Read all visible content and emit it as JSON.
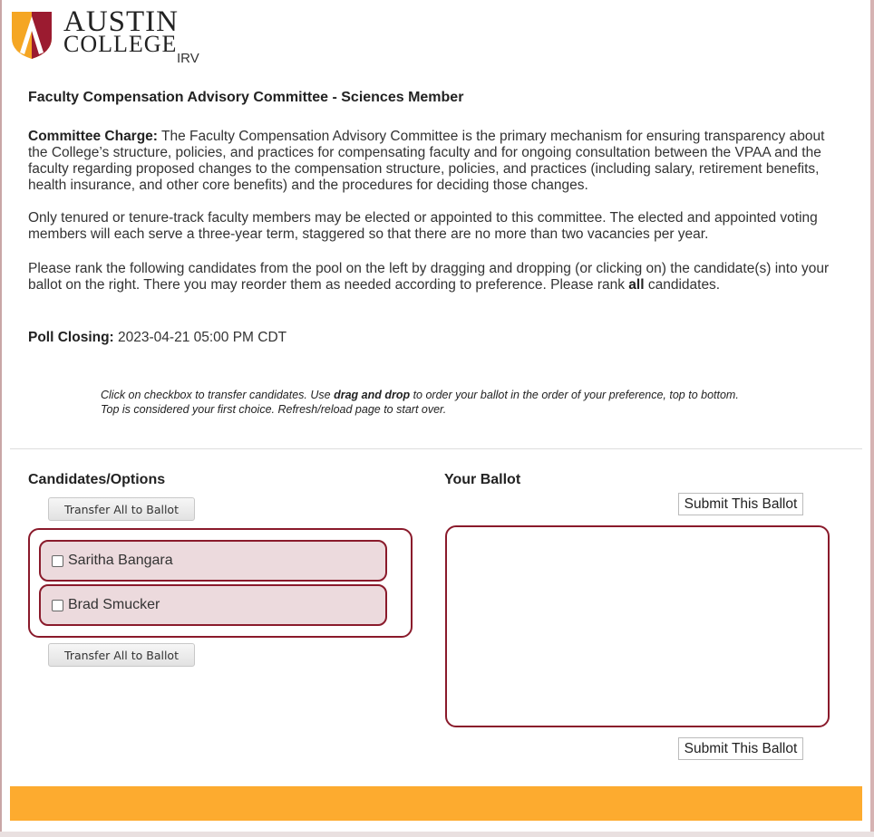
{
  "branding": {
    "logo_line1": "AUSTIN",
    "logo_line2": "COLLEGE",
    "app_name": "IRV",
    "colors": {
      "shield_gold": "#f5a623",
      "shield_red": "#9b1b30",
      "footer": "#fdab2f",
      "border": "#8a1a2b"
    }
  },
  "poll": {
    "title": "Faculty Compensation Advisory Committee - Sciences Member",
    "charge_label": "Committee Charge:",
    "charge_text": " The Faculty Compensation Advisory Committee is the primary mechanism for ensuring transparency about the College’s structure, policies, and practices for compensating faculty and for ongoing consultation between the VPAA and the faculty regarding proposed changes to the compensation structure, policies, and practices (including salary, retirement benefits, health insurance, and other core benefits) and the procedures for deciding those changes.",
    "eligibility_text": "Only tenured or tenure-track faculty members may be elected or appointed to this committee. The elected and appointed voting members will each serve a three-year term, staggered so that there are no more than two vacancies per year.",
    "rank_text_before": "Please rank the following candidates from the pool on the left by dragging and dropping (or clicking on) the candidate(s) into your ballot on the right. There you may reorder them as needed according to preference. Please rank ",
    "rank_text_bold": "all",
    "rank_text_after": " candidates.",
    "closing_label": "Poll Closing:",
    "closing_value": " 2023-04-21 05:00 PM CDT"
  },
  "instructions": {
    "part1": "Click on checkbox to transfer candidates. Use ",
    "bold": "drag and drop",
    "part2": " to order your ballot in the order of your preference, top to bottom. Top is considered your first choice. Refresh/reload page to start over."
  },
  "candidates": {
    "heading": "Candidates/Options",
    "transfer_label": "Transfer All to Ballot",
    "items": [
      {
        "name": "Saritha Bangara",
        "checked": false
      },
      {
        "name": "Brad Smucker",
        "checked": false
      }
    ]
  },
  "ballot": {
    "heading": "Your Ballot",
    "submit_label": "Submit This Ballot",
    "items": []
  }
}
